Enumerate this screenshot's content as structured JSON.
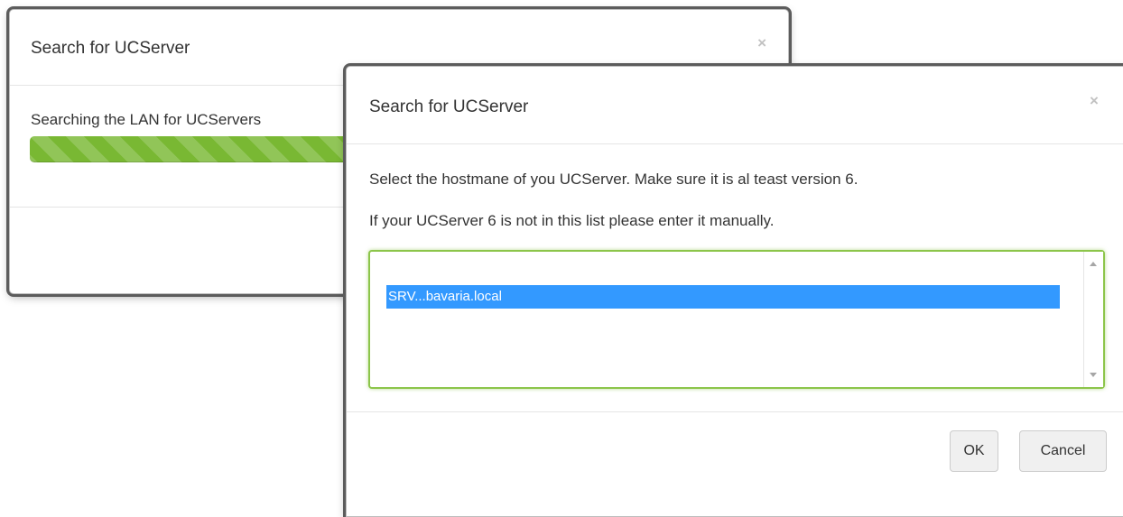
{
  "back_dialog": {
    "title": "Search for UCServer",
    "close_glyph": "×",
    "message": "Searching the LAN for UCServers",
    "progress_percent": 100,
    "progress_color": "#79b833"
  },
  "front_dialog": {
    "title": "Search for UCServer",
    "close_glyph": "×",
    "instruction": "Select the hostmane of you UCServer. Make sure it is al teast version 6.",
    "hint": "If your UCServer 6 is not in this list please enter it manually.",
    "list": {
      "items": [
        "SRV...bavaria.local"
      ],
      "selected_index": 0,
      "border_color": "#8cc54a",
      "selection_color": "#3399ff"
    },
    "buttons": {
      "ok": "OK",
      "cancel": "Cancel"
    }
  }
}
